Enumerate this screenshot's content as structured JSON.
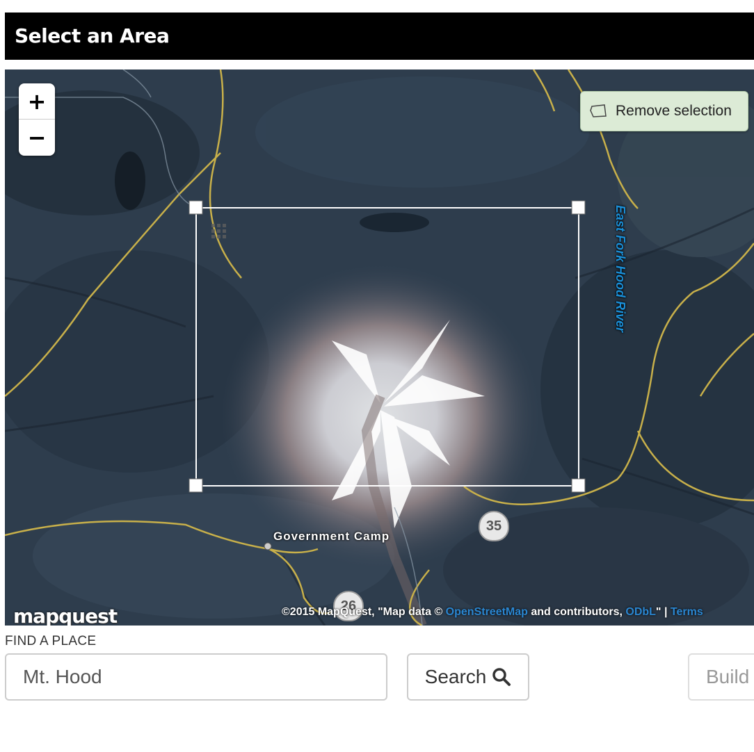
{
  "header": {
    "title": "Select an Area"
  },
  "map": {
    "zoom_in_label": "+",
    "zoom_out_label": "−",
    "remove_selection_label": "Remove selection",
    "places": {
      "government_camp": "Government Camp"
    },
    "river": "East Fork Hood River",
    "highways": {
      "h35": "35",
      "h26": "26"
    },
    "logo": "mapquest",
    "attribution": {
      "prefix": "©2015 MapQuest, \"Map data © ",
      "osm_link": "OpenStreetMap",
      "middle": " and contributors, ",
      "odbl_link": "ODbL",
      "sep": "\" | ",
      "terms_link": "Terms"
    }
  },
  "find": {
    "label": "FIND A PLACE",
    "search_value": "Mt. Hood",
    "search_button_label": "Search",
    "build_button_label": "Build"
  },
  "colors": {
    "header_bg": "#000000",
    "road": "#c8b04a",
    "remove_button_bg": "#dcebd6"
  },
  "icons": [
    "polygon-icon",
    "search-icon",
    "drag-grid-icon"
  ]
}
